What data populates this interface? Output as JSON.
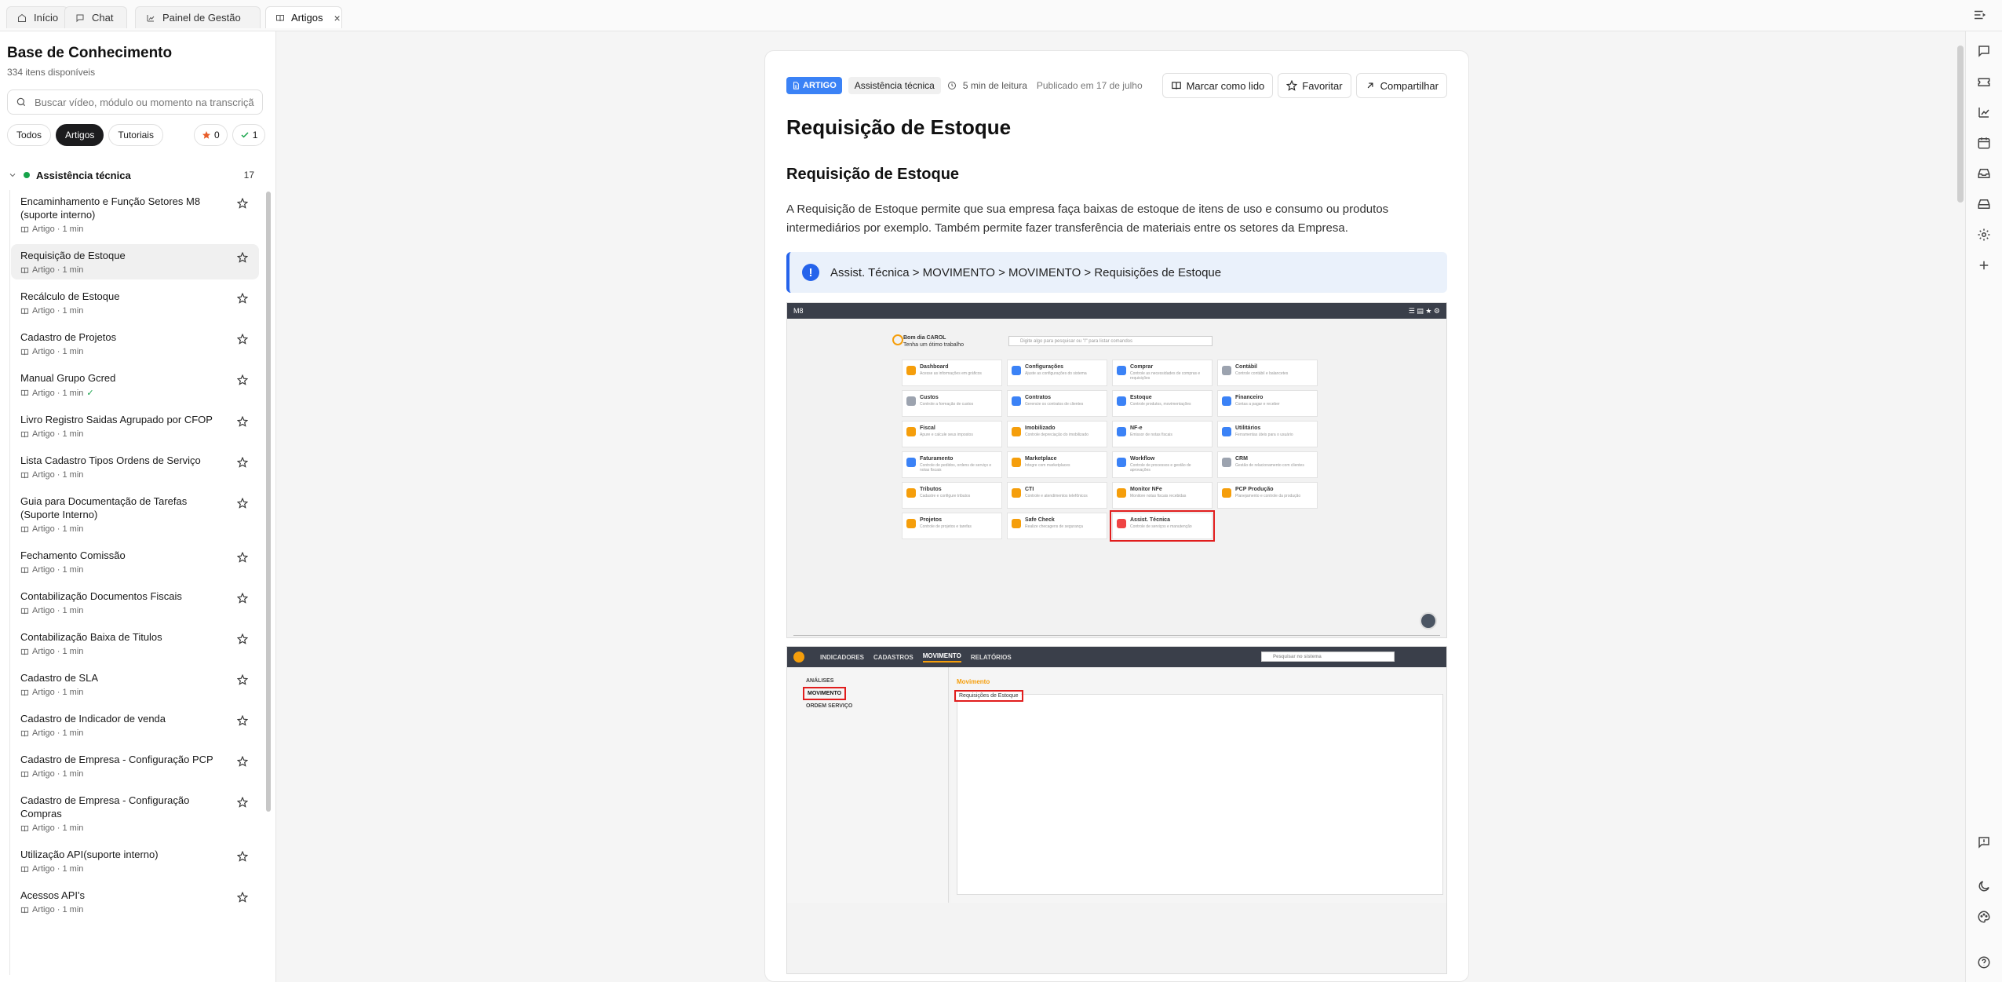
{
  "tabs": [
    {
      "label": "Início",
      "icon": "home-icon"
    },
    {
      "label": "Chat",
      "icon": "chat-icon"
    },
    {
      "label": "Painel de Gestão",
      "icon": "chart-icon"
    },
    {
      "label": "Artigos",
      "icon": "book-icon",
      "active": true
    }
  ],
  "sidebar": {
    "title": "Base de Conhecimento",
    "subtitle": "334 itens disponíveis",
    "search_placeholder": "Buscar vídeo, módulo ou momento na transcrição...",
    "filters": [
      {
        "label": "Todos"
      },
      {
        "label": "Artigos",
        "active": true
      },
      {
        "label": "Tutoriais"
      }
    ],
    "favorites_count": "0",
    "read_count": "1",
    "group": {
      "label": "Assistência técnica",
      "count": "17",
      "color": "#16a34a"
    },
    "items": [
      {
        "title": "Encaminhamento e Função Setores M8 (suporte interno)",
        "meta": "Artigo · 1 min"
      },
      {
        "title": "Requisição de Estoque",
        "meta": "Artigo · 1 min",
        "selected": true
      },
      {
        "title": "Recálculo de Estoque",
        "meta": "Artigo · 1 min"
      },
      {
        "title": "Cadastro de Projetos",
        "meta": "Artigo · 1 min"
      },
      {
        "title": "Manual Grupo Gcred",
        "meta": "Artigo · 1 min",
        "read": true
      },
      {
        "title": "Livro Registro Saidas Agrupado por CFOP",
        "meta": "Artigo · 1 min"
      },
      {
        "title": "Lista Cadastro Tipos Ordens de Serviço",
        "meta": "Artigo · 1 min"
      },
      {
        "title": "Guia para Documentação de Tarefas (Suporte Interno)",
        "meta": "Artigo · 1 min"
      },
      {
        "title": "Fechamento Comissão",
        "meta": "Artigo · 1 min"
      },
      {
        "title": "Contabilização Documentos Fiscais",
        "meta": "Artigo · 1 min"
      },
      {
        "title": "Contabilização Baixa de Titulos",
        "meta": "Artigo · 1 min"
      },
      {
        "title": "Cadastro de SLA",
        "meta": "Artigo · 1 min"
      },
      {
        "title": "Cadastro de Indicador de venda",
        "meta": "Artigo · 1 min"
      },
      {
        "title": "Cadastro de Empresa - Configuração PCP",
        "meta": "Artigo · 1 min"
      },
      {
        "title": "Cadastro de Empresa - Configuração Compras",
        "meta": "Artigo · 1 min"
      },
      {
        "title": "Utilização API(suporte interno)",
        "meta": "Artigo · 1 min"
      },
      {
        "title": "Acessos API's",
        "meta": "Artigo · 1 min"
      }
    ]
  },
  "article": {
    "badge": "ARTIGO",
    "category": "Assistência técnica",
    "read_time": "5 min de leitura",
    "published": "Publicado em 17 de julho",
    "actions": {
      "mark_read": "Marcar como lido",
      "favorite": "Favoritar",
      "share": "Compartilhar"
    },
    "title": "Requisição de Estoque",
    "heading": "Requisição de Estoque",
    "paragraph": "A Requisição de Estoque permite que sua empresa faça baixas de estoque de itens de uso e consumo ou produtos intermediários por exemplo. Também permite fazer transferência de materiais entre os setores da Empresa.",
    "callout": "Assist. Técnica > MOVIMENTO > MOVIMENTO > Requisições de Estoque"
  },
  "screenshot1": {
    "greeting_line1": "Bom dia CAROL",
    "greeting_line2": "Tenha um ótimo trabalho",
    "search_placeholder": "Digite algo para pesquisar ou \"/\" para listar comandos",
    "tiles": [
      {
        "title": "Dashboard",
        "desc": "Acesse as informações em gráficos",
        "color": "#f59e0b"
      },
      {
        "title": "Configurações",
        "desc": "Ajuste as configurações do sistema",
        "color": "#3b82f6"
      },
      {
        "title": "Comprar",
        "desc": "Controle as necessidades de compras e requisições",
        "color": "#3b82f6"
      },
      {
        "title": "Contábil",
        "desc": "Controle contábil e balancetes",
        "color": "#9ca3af"
      },
      {
        "title": "Custos",
        "desc": "Controle a formação de custos",
        "color": "#9ca3af"
      },
      {
        "title": "Contratos",
        "desc": "Gerencie os contratos de clientes",
        "color": "#3b82f6"
      },
      {
        "title": "Estoque",
        "desc": "Controle produtos, movimentações",
        "color": "#3b82f6"
      },
      {
        "title": "Financeiro",
        "desc": "Contas a pagar e receber",
        "color": "#3b82f6"
      },
      {
        "title": "Fiscal",
        "desc": "Apure e calcule seus impostos",
        "color": "#f59e0b"
      },
      {
        "title": "Imobilizado",
        "desc": "Controle depreciação do imobilizado",
        "color": "#f59e0b"
      },
      {
        "title": "NF-e",
        "desc": "Emissor de notas fiscais",
        "color": "#3b82f6"
      },
      {
        "title": "Utilitários",
        "desc": "Ferramentas úteis para o usuário",
        "color": "#3b82f6"
      },
      {
        "title": "Faturamento",
        "desc": "Controle de pedidos, ordens de serviço e notas fiscais",
        "color": "#3b82f6"
      },
      {
        "title": "Marketplace",
        "desc": "Integre com marketplaces",
        "color": "#f59e0b"
      },
      {
        "title": "Workflow",
        "desc": "Controle de processos e gestão de aprovações",
        "color": "#3b82f6"
      },
      {
        "title": "CRM",
        "desc": "Gestão de relacionamento com clientes",
        "color": "#9ca3af"
      },
      {
        "title": "Tributos",
        "desc": "Cadastre e configure tributos",
        "color": "#f59e0b"
      },
      {
        "title": "CTI",
        "desc": "Controle e atendimentos telefônicos",
        "color": "#f59e0b"
      },
      {
        "title": "Monitor NFe",
        "desc": "Monitore notas fiscais recebidas",
        "color": "#f59e0b"
      },
      {
        "title": "PCP Produção",
        "desc": "Planejamento e controle da produção",
        "color": "#f59e0b"
      },
      {
        "title": "Projetos",
        "desc": "Controle de projetos e tarefas",
        "color": "#f59e0b"
      },
      {
        "title": "Safe Check",
        "desc": "Realize checagens de segurança",
        "color": "#f59e0b"
      },
      {
        "title": "Assist. Técnica",
        "desc": "Controle de serviços e manutenção",
        "color": "#ef4444",
        "highlight": true
      }
    ]
  },
  "screenshot2": {
    "nav": [
      "INDICADORES",
      "CADASTROS",
      "MOVIMENTO",
      "RELATÓRIOS"
    ],
    "nav_active": "MOVIMENTO",
    "search_placeholder": "Pesquisar no sistema",
    "side": [
      "ANÁLISES",
      "MOVIMENTO",
      "ORDEM SERVIÇO"
    ],
    "panel_title": "Movimento",
    "panel_item": "Requisições de Estoque"
  },
  "colors": {
    "accent": "#3b82f6",
    "group_dot": "#16a34a",
    "highlight_red": "#e11d1d"
  }
}
